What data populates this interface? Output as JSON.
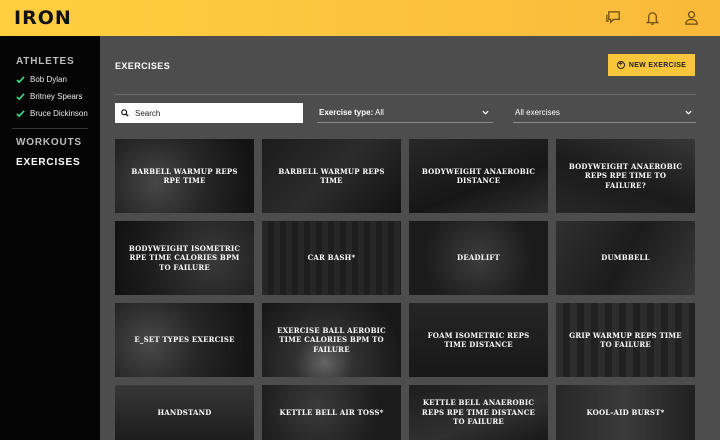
{
  "app": {
    "logo": "IRON"
  },
  "topbar": {
    "icons": [
      "chat-icon",
      "bell-icon",
      "user-icon"
    ]
  },
  "sidebar": {
    "athletes_heading": "ATHLETES",
    "athletes": [
      {
        "name": "Bob Dylan"
      },
      {
        "name": "Britney Spears"
      },
      {
        "name": "Bruce Dickinson"
      }
    ],
    "workouts_label": "WORKOUTS",
    "exercises_label": "EXERCISES"
  },
  "main": {
    "title": "EXERCISES",
    "new_button": "NEW EXERCISE",
    "search": {
      "placeholder": "Search",
      "value": ""
    },
    "type_filter": {
      "label": "Exercise type:",
      "value": "All"
    },
    "list_filter": {
      "value": "All exercises"
    },
    "tiles": [
      {
        "name": "BARBELL WARMUP REPS RPE TIME"
      },
      {
        "name": "BARBELL WARMUP REPS TIME"
      },
      {
        "name": "BODYWEIGHT ANAEROBIC DISTANCE"
      },
      {
        "name": "BODYWEIGHT ANAEROBIC REPS RPE TIME TO FAILURE?"
      },
      {
        "name": "BODYWEIGHT ISOMETRIC RPE TIME CALORIES BPM TO FAILURE"
      },
      {
        "name": "CAR BASH*"
      },
      {
        "name": "DEADLIFT"
      },
      {
        "name": "DUMBBELL"
      },
      {
        "name": "E_SET TYPES EXERCISE"
      },
      {
        "name": "EXERCISE BALL AEROBIC TIME CALORIES BPM TO FAILURE"
      },
      {
        "name": "FOAM ISOMETRIC REPS TIME DISTANCE"
      },
      {
        "name": "GRIP WARMUP REPS TIME TO FAILURE"
      },
      {
        "name": "HANDSTAND"
      },
      {
        "name": "KETTLE BELL AIR TOSS*"
      },
      {
        "name": "KETTLE BELL ANAEROBIC REPS RPE TIME DISTANCE TO FAILURE"
      },
      {
        "name": "KOOL-AID BURST*"
      }
    ]
  },
  "colors": {
    "accent": "#f9c53b",
    "sidebar": "#050505",
    "main_bg": "#4d4d4d",
    "check": "#3ddc84"
  }
}
